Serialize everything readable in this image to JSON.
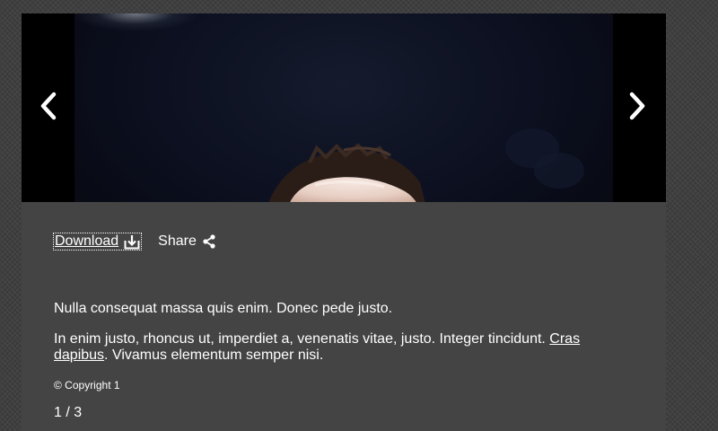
{
  "gallery": {
    "image_alt": "",
    "prev_icon": "chevron-left-icon",
    "next_icon": "chevron-right-icon"
  },
  "actions": {
    "download_label": "Download",
    "download_icon": "download-icon",
    "share_label": "Share",
    "share_icon": "share-icon"
  },
  "caption": {
    "paragraph1": "Nulla consequat massa quis enim. Donec pede justo.",
    "paragraph2_before_link": "In enim justo, rhoncus ut, imperdiet a, venenatis vitae, justo. Integer tincidunt. ",
    "paragraph2_link": "Cras dapibus",
    "paragraph2_after_link": ". Vivamus elementum semper nisi.",
    "copyright": "© Copyright 1"
  },
  "pagination": {
    "current": "1",
    "separator": "/",
    "total": "3"
  },
  "colors": {
    "page_background": "#3f3f3f",
    "panel_background": "#444444",
    "stage_background": "#000000",
    "text": "#ffffff"
  }
}
